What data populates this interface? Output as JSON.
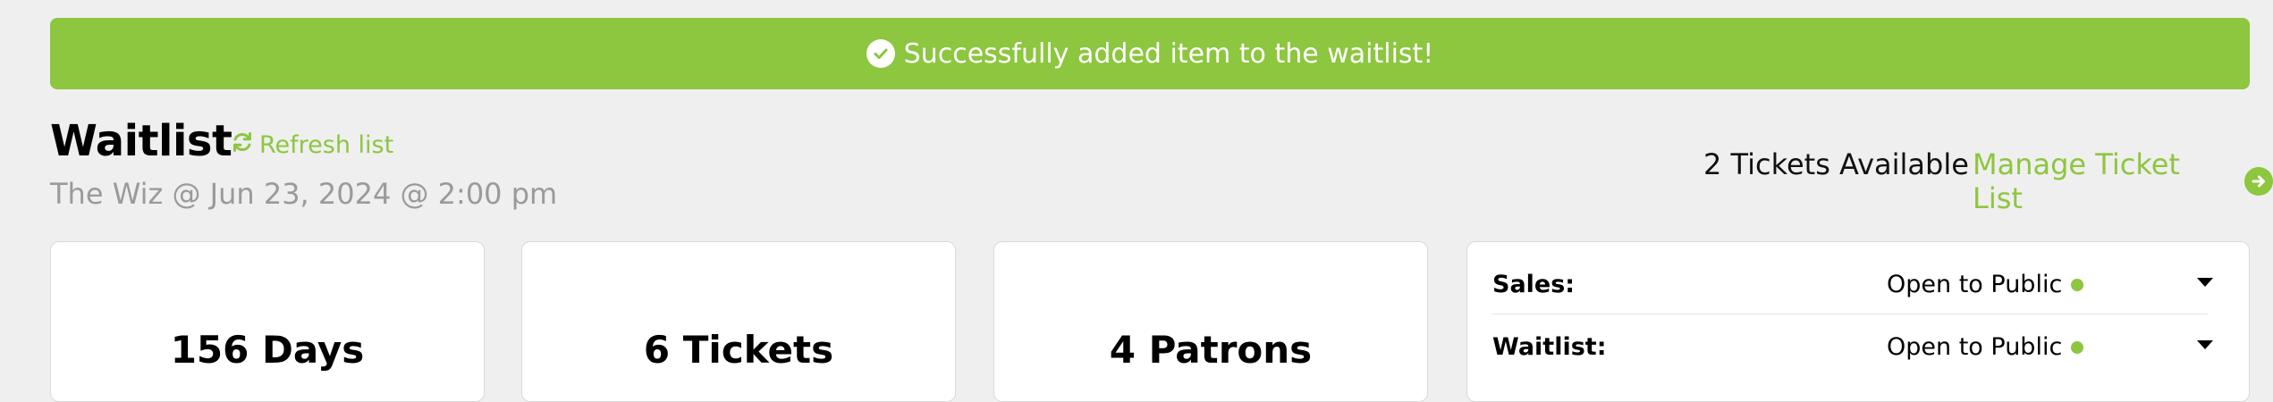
{
  "banner": {
    "message": "Successfully added item to the waitlist!"
  },
  "header": {
    "title": "Waitlist",
    "refresh_label": "Refresh list",
    "subtitle": "The Wiz @ Jun 23, 2024 @ 2:00 pm",
    "tickets_available": "2 Tickets Available",
    "manage_label": "Manage Ticket List"
  },
  "stats": [
    {
      "value": "156 Days"
    },
    {
      "value": "6 Tickets"
    },
    {
      "value": "4 Patrons"
    }
  ],
  "status_panel": {
    "rows": [
      {
        "label": "Sales:",
        "value": "Open to Public"
      },
      {
        "label": "Waitlist:",
        "value": "Open to Public"
      }
    ]
  },
  "colors": {
    "accent": "#8dc63f",
    "background": "#efefef",
    "muted_text": "#9a9a9a"
  },
  "icons": {
    "banner": "check-circle-icon",
    "refresh": "refresh-icon",
    "manage": "arrow-circle-right-icon",
    "status": "status-dot-icon",
    "dropdown": "caret-down-icon"
  }
}
